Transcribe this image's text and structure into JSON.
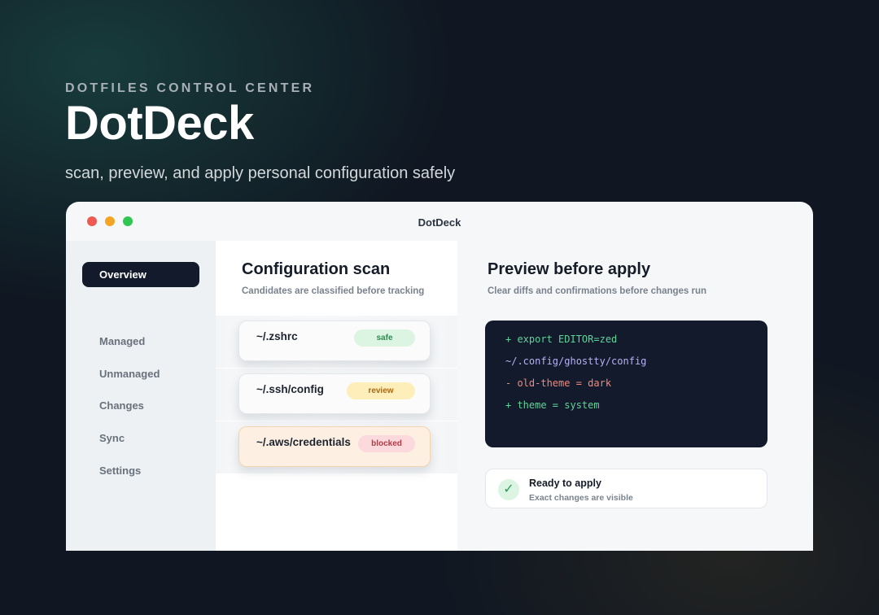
{
  "hero": {
    "eyebrow": "DOTFILES CONTROL CENTER",
    "brand": "DotDeck",
    "tagline": "scan, preview, and apply personal configuration safely"
  },
  "window": {
    "title": "DotDeck"
  },
  "sidebar": {
    "active": "Overview",
    "items": [
      {
        "label": "Managed"
      },
      {
        "label": "Unmanaged"
      },
      {
        "label": "Changes"
      },
      {
        "label": "Sync"
      },
      {
        "label": "Settings"
      }
    ]
  },
  "scan": {
    "title": "Configuration scan",
    "subtitle": "Candidates are classified before tracking",
    "candidates": [
      {
        "path": "~/.zshrc",
        "badge": "safe",
        "status_color": "#2e8a4e"
      },
      {
        "path": "~/.ssh/config",
        "badge": "review",
        "status_color": "#a86a14"
      },
      {
        "path": "~/.aws/credentials",
        "badge": "blocked",
        "status_color": "#b33a48"
      }
    ]
  },
  "preview": {
    "title": "Preview before apply",
    "subtitle": "Clear diffs and confirmations before changes run",
    "diff": [
      "+ export EDITOR=zed",
      "~/.config/ghostty/config",
      "- old-theme = dark",
      "+ theme = system"
    ],
    "status": {
      "icon": "check-icon",
      "title": "Ready to apply",
      "subtitle": "Exact changes are visible"
    }
  },
  "colors": {
    "accent_dark": "#121a2b",
    "safe": "#dcf5e3",
    "review": "#fdeeba",
    "blocked": "#fbd9dc"
  }
}
